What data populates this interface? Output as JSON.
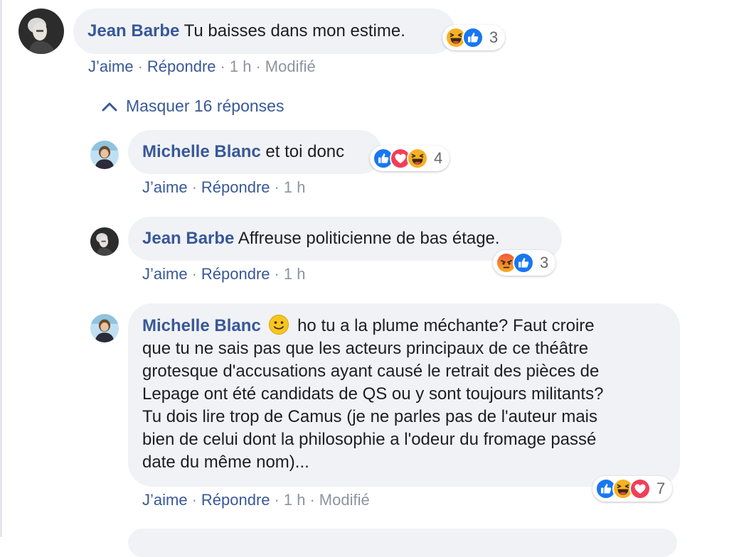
{
  "comment": {
    "author": "Jean Barbe",
    "text": "Tu baisses dans mon estime.",
    "reaction_count": "3",
    "actions": {
      "like": "J’aime",
      "reply": "Répondre",
      "time": "1 h",
      "edited": "Modifié"
    },
    "reactions": [
      "haha-icon",
      "like-icon"
    ]
  },
  "toggle_label": "Masquer 16 réponses",
  "replies": [
    {
      "author": "Michelle Blanc",
      "text": "et toi donc",
      "reaction_count": "4",
      "actions": {
        "like": "J’aime",
        "reply": "Répondre",
        "time": "1 h"
      },
      "reactions": [
        "like-icon",
        "love-icon",
        "haha-icon"
      ]
    },
    {
      "author": "Jean Barbe",
      "text": "Affreuse politicienne de bas étage.",
      "reaction_count": "3",
      "actions": {
        "like": "J’aime",
        "reply": "Répondre",
        "time": "1 h"
      },
      "reactions": [
        "angry-icon",
        "like-icon"
      ]
    },
    {
      "author": "Michelle Blanc",
      "text_lines": [
        "ho tu a la plume méchante? Faut croire",
        "que tu ne sais pas que les acteurs principaux de ce théâtre",
        "grotesque d'accusations ayant causé le retrait des pièces de",
        "Lepage ont été candidats de QS ou y sont toujours militants?",
        "Tu dois lire trop de Camus (je ne parles pas de l'auteur mais",
        "bien de celui dont la philosophie a l'odeur du fromage passé",
        "date du même nom)..."
      ],
      "reaction_count": "7",
      "actions": {
        "like": "J’aime",
        "reply": "Répondre",
        "time": "1 h",
        "edited": "Modifié"
      },
      "reactions": [
        "like-icon",
        "haha-icon",
        "love-icon"
      ]
    }
  ],
  "colors": {
    "link": "#385898",
    "bubble": "#f0f2f5",
    "muted": "#8d949e",
    "like": "#1877f2",
    "love": "#f33e58",
    "haha": "#f7b125",
    "angry": "#e9710f"
  }
}
